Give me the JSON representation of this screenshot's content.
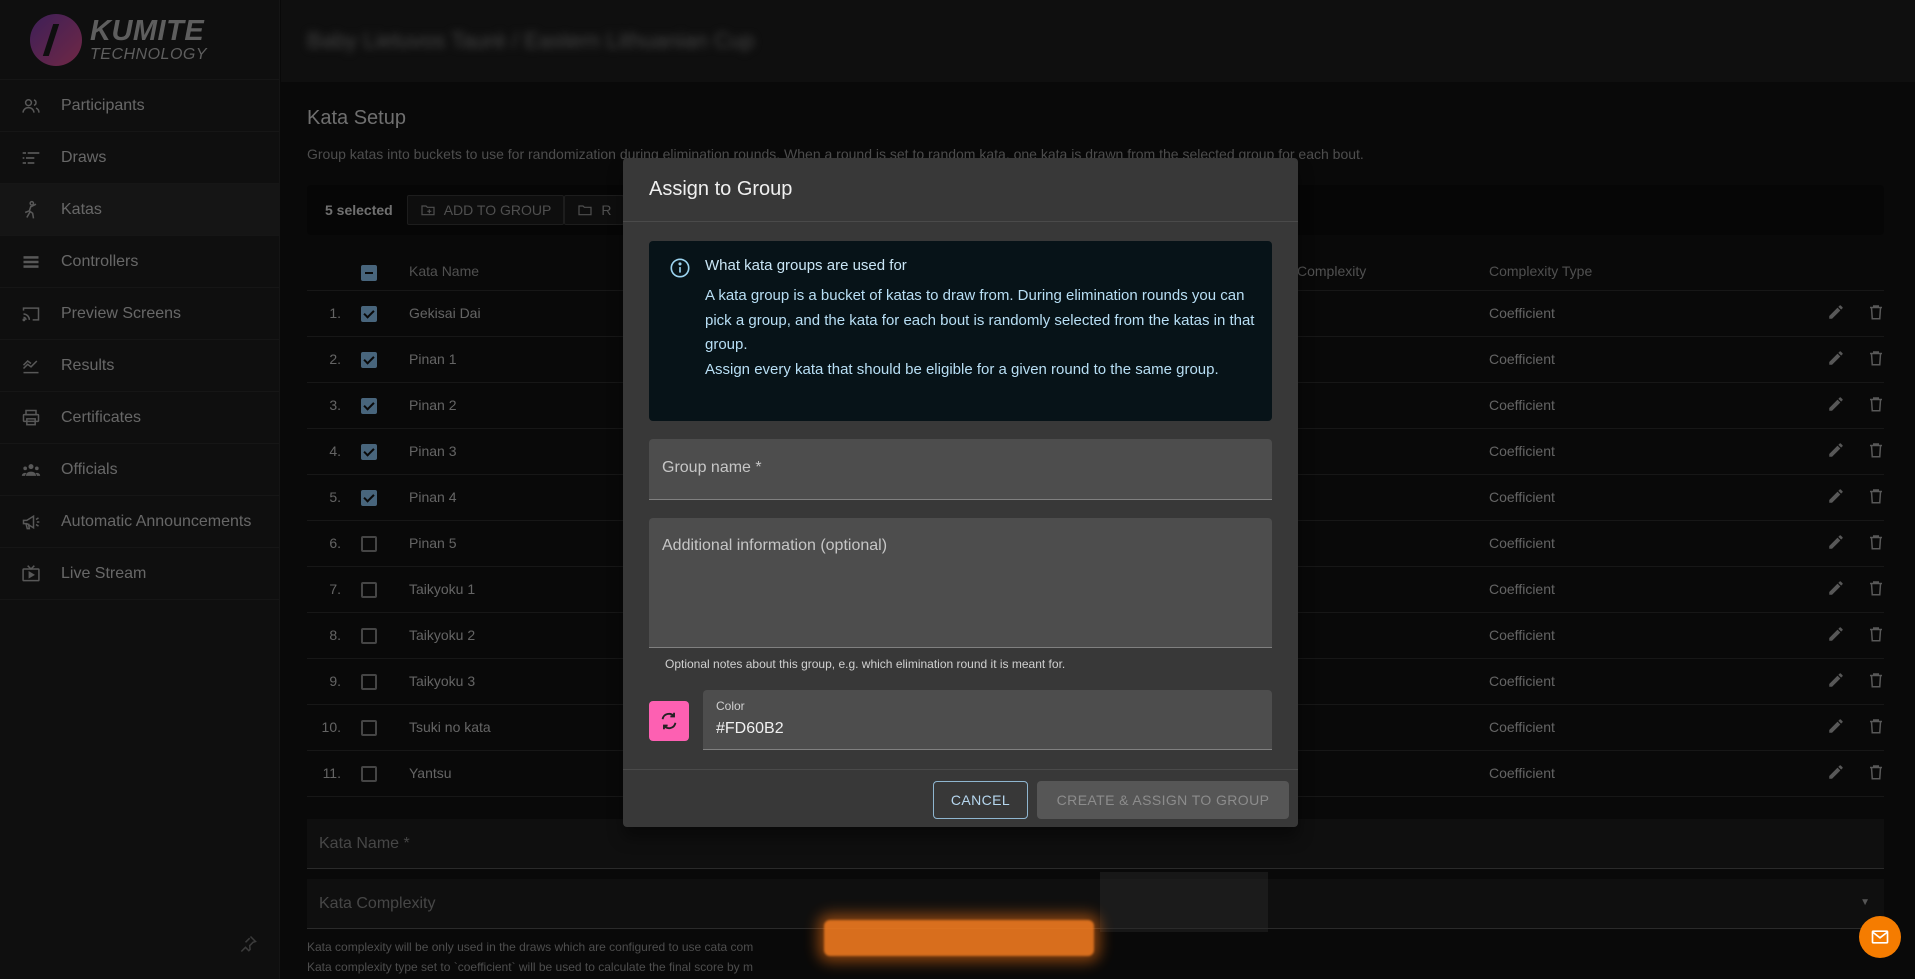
{
  "app": {
    "logo_main": "KUMITE",
    "logo_sub": "TECHNOLOGY",
    "page_title": "Baby Lietuvos Taurė / Eastern Lithuanian Cup"
  },
  "sidebar": {
    "items": [
      {
        "label": "Participants",
        "icon": "people-icon"
      },
      {
        "label": "Draws",
        "icon": "draws-icon"
      },
      {
        "label": "Katas",
        "icon": "kata-icon"
      },
      {
        "label": "Controllers",
        "icon": "controllers-icon"
      },
      {
        "label": "Preview Screens",
        "icon": "cast-icon"
      },
      {
        "label": "Results",
        "icon": "chart-icon"
      },
      {
        "label": "Certificates",
        "icon": "print-icon"
      },
      {
        "label": "Officials",
        "icon": "group-icon"
      },
      {
        "label": "Automatic Announcements",
        "icon": "megaphone-icon"
      },
      {
        "label": "Live Stream",
        "icon": "stream-icon"
      }
    ],
    "active": "Katas"
  },
  "kata_setup": {
    "title": "Kata Setup",
    "description": "Group katas into buckets to use for randomization during elimination rounds. When a round is set to random kata, one kata is drawn from the selected group for each bout.",
    "toolbar": {
      "selected": "5 selected",
      "add_to_group": "ADD TO GROUP",
      "second_button": "R"
    },
    "columns": {
      "name": "Kata Name",
      "complexity": "Complexity",
      "complexity_type": "Complexity Type"
    },
    "rows": [
      {
        "num": "1.",
        "name": "Gekisai Dai",
        "type": "Coefficient",
        "checked": true
      },
      {
        "num": "2.",
        "name": "Pinan 1",
        "type": "Coefficient",
        "checked": true
      },
      {
        "num": "3.",
        "name": "Pinan 2",
        "type": "Coefficient",
        "checked": true
      },
      {
        "num": "4.",
        "name": "Pinan 3",
        "type": "Coefficient",
        "checked": true
      },
      {
        "num": "5.",
        "name": "Pinan 4",
        "type": "Coefficient",
        "checked": true
      },
      {
        "num": "6.",
        "name": "Pinan 5",
        "type": "Coefficient",
        "checked": false
      },
      {
        "num": "7.",
        "name": "Taikyoku 1",
        "type": "Coefficient",
        "checked": false
      },
      {
        "num": "8.",
        "name": "Taikyoku 2",
        "type": "Coefficient",
        "checked": false
      },
      {
        "num": "9.",
        "name": "Taikyoku 3",
        "type": "Coefficient",
        "checked": false
      },
      {
        "num": "10.",
        "name": "Tsuki no kata",
        "type": "Coefficient",
        "checked": false
      },
      {
        "num": "11.",
        "name": "Yantsu",
        "type": "Coefficient",
        "checked": false
      }
    ],
    "form": {
      "kata_name_placeholder": "Kata Name *",
      "kata_complexity_placeholder": "Kata Complexity",
      "helper_1": "Kata complexity will be only used in the draws which are configured to use cata com",
      "helper_2": "Kata complexity type set to `coefficient` will be used to calculate the final score by m"
    }
  },
  "dialog": {
    "title": "Assign to Group",
    "info_title": "What kata groups are used for",
    "info_body_1": "A kata group is a bucket of katas to draw from. During elimination rounds you can pick a group, and the kata for each bout is randomly selected from the katas in that group.",
    "info_body_2": "Assign every kata that should be eligible for a given round to the same group.",
    "group_name_label": "Group name *",
    "additional_info_label": "Additional information (optional)",
    "additional_info_hint": "Optional notes about this group, e.g. which elimination round it is meant for.",
    "color_label": "Color",
    "color_value": "#FD60B2",
    "cancel_label": "CANCEL",
    "create_label": "CREATE & ASSIGN TO GROUP"
  },
  "colors": {
    "accent": "#90caf9",
    "swatch": "#FD60B2",
    "fab": "#f57c00"
  }
}
